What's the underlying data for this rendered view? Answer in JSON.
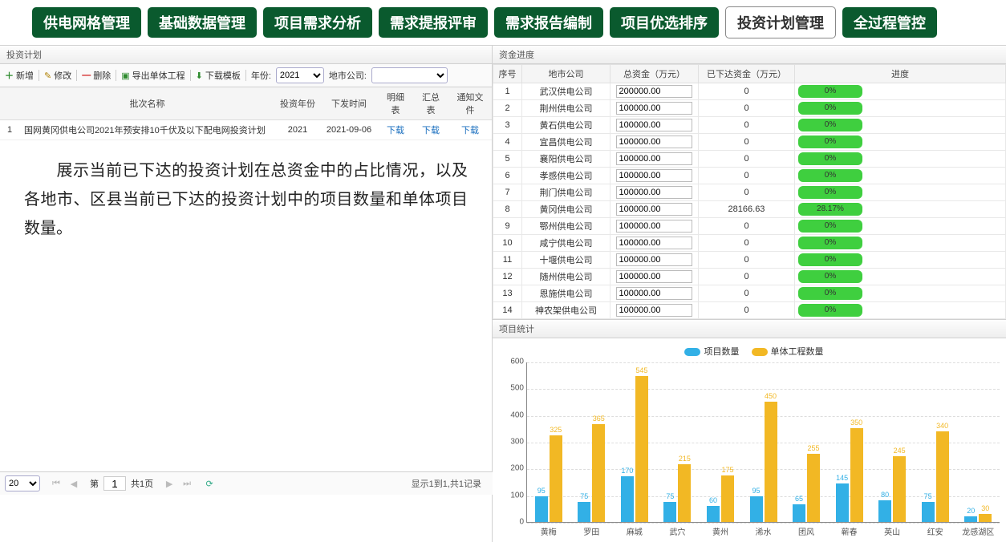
{
  "tabs": [
    {
      "label": "供电网格管理",
      "active": false
    },
    {
      "label": "基础数据管理",
      "active": false
    },
    {
      "label": "项目需求分析",
      "active": false
    },
    {
      "label": "需求提报评审",
      "active": false
    },
    {
      "label": "需求报告编制",
      "active": false
    },
    {
      "label": "项目优选排序",
      "active": false
    },
    {
      "label": "投资计划管理",
      "active": true
    },
    {
      "label": "全过程管控",
      "active": false
    }
  ],
  "left": {
    "panel_title": "投资计划",
    "toolbar": {
      "add": "新增",
      "edit": "修改",
      "del": "删除",
      "export": "导出单体工程",
      "download": "下载模板",
      "year_label": "年份:",
      "year_value": "2021",
      "city_label": "地市公司:",
      "city_value": ""
    },
    "grid": {
      "headers": {
        "name": "批次名称",
        "year": "投资年份",
        "time": "下发时间",
        "detail": "明细表",
        "summary": "汇总表",
        "notice": "通知文件"
      },
      "rows": [
        {
          "idx": "1",
          "name": "国网黄冈供电公司2021年预安排10千伏及以下配电网投资计划",
          "year": "2021",
          "time": "2021-09-06",
          "detail": "下载",
          "summary": "下载",
          "notice": "下载"
        }
      ]
    },
    "description": "展示当前已下达的投资计划在总资金中的占比情况，以及各地市、区县当前已下达的投资计划中的项目数量和单体项目数量。",
    "pager": {
      "pagesize": "20",
      "page": "1",
      "total_pages": "共1页",
      "info": "显示1到1,共1记录"
    }
  },
  "right": {
    "funds_title": "资金进度",
    "fund_headers": {
      "idx": "序号",
      "company": "地市公司",
      "total": "总资金（万元）",
      "issued": "已下达资金（万元）",
      "progress": "进度"
    },
    "fund_rows": [
      {
        "idx": "1",
        "company": "武汉供电公司",
        "total": "200000.00",
        "issued": "0",
        "pct": 0,
        "pct_text": "0%"
      },
      {
        "idx": "2",
        "company": "荆州供电公司",
        "total": "100000.00",
        "issued": "0",
        "pct": 0,
        "pct_text": "0%"
      },
      {
        "idx": "3",
        "company": "黄石供电公司",
        "total": "100000.00",
        "issued": "0",
        "pct": 0,
        "pct_text": "0%"
      },
      {
        "idx": "4",
        "company": "宜昌供电公司",
        "total": "100000.00",
        "issued": "0",
        "pct": 0,
        "pct_text": "0%"
      },
      {
        "idx": "5",
        "company": "襄阳供电公司",
        "total": "100000.00",
        "issued": "0",
        "pct": 0,
        "pct_text": "0%"
      },
      {
        "idx": "6",
        "company": "孝感供电公司",
        "total": "100000.00",
        "issued": "0",
        "pct": 0,
        "pct_text": "0%"
      },
      {
        "idx": "7",
        "company": "荆门供电公司",
        "total": "100000.00",
        "issued": "0",
        "pct": 0,
        "pct_text": "0%"
      },
      {
        "idx": "8",
        "company": "黄冈供电公司",
        "total": "100000.00",
        "issued": "28166.63",
        "pct": 28.17,
        "pct_text": "28.17%"
      },
      {
        "idx": "9",
        "company": "鄂州供电公司",
        "total": "100000.00",
        "issued": "0",
        "pct": 0,
        "pct_text": "0%"
      },
      {
        "idx": "10",
        "company": "咸宁供电公司",
        "total": "100000.00",
        "issued": "0",
        "pct": 0,
        "pct_text": "0%"
      },
      {
        "idx": "11",
        "company": "十堰供电公司",
        "total": "100000.00",
        "issued": "0",
        "pct": 0,
        "pct_text": "0%"
      },
      {
        "idx": "12",
        "company": "随州供电公司",
        "total": "100000.00",
        "issued": "0",
        "pct": 0,
        "pct_text": "0%"
      },
      {
        "idx": "13",
        "company": "恩施供电公司",
        "total": "100000.00",
        "issued": "0",
        "pct": 0,
        "pct_text": "0%"
      },
      {
        "idx": "14",
        "company": "神农架供电公司",
        "total": "100000.00",
        "issued": "0",
        "pct": 0,
        "pct_text": "0%"
      }
    ],
    "stats_title": "项目统计",
    "legend": {
      "s1": "项目数量",
      "s2": "单体工程数量"
    }
  },
  "chart_data": {
    "type": "bar",
    "title": "项目统计",
    "ylim": [
      0,
      600
    ],
    "yticks": [
      0,
      100,
      200,
      300,
      400,
      500,
      600
    ],
    "categories": [
      "黄梅",
      "罗田",
      "麻城",
      "武穴",
      "黄州",
      "浠水",
      "团风",
      "蕲春",
      "英山",
      "红安",
      "龙感湖区"
    ],
    "series": [
      {
        "name": "项目数量",
        "color": "#32b0e6",
        "values": [
          95,
          75,
          170,
          75,
          60,
          95,
          65,
          145,
          80,
          75,
          20
        ]
      },
      {
        "name": "单体工程数量",
        "color": "#f2b824",
        "values": [
          325,
          365,
          545,
          215,
          175,
          450,
          255,
          350,
          245,
          340,
          30
        ]
      }
    ]
  }
}
